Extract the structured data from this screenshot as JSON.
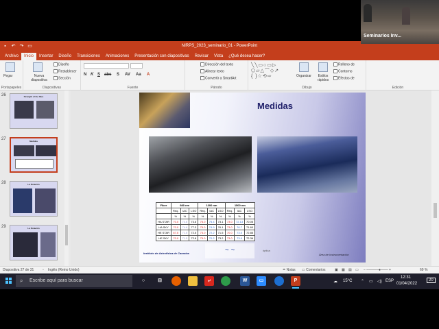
{
  "titlebar": {
    "title": "NIRPS_2023_seminario_01 - PowerPoint",
    "qat": [
      "save-icon",
      "undo-icon",
      "redo-icon",
      "present-icon"
    ]
  },
  "tabs": [
    "Archivo",
    "Inicio",
    "Insertar",
    "Diseño",
    "Transiciones",
    "Animaciones",
    "Presentación con diapositivas",
    "Revisar",
    "Vista",
    "¿Qué desea hacer?"
  ],
  "active_tab": "Inicio",
  "ribbon": {
    "groups": {
      "portapapeles": "Portapapeles",
      "diapositivas": "Diapositivas",
      "fuente": "Fuente",
      "parrafo": "Párrafo",
      "dibujo": "Dibujo",
      "edicion": "Edición"
    },
    "pegar": "Pegar",
    "nueva_diapositiva": "Nueva diapositiva",
    "diseno": "Diseño",
    "restablecer": "Restablecer",
    "seccion": "Sección",
    "direccion_texto": "Dirección del texto",
    "alinear_texto": "Alinear texto",
    "convertir_smartart": "Convertir a SmartArt",
    "organizar": "Organizar",
    "estilos_rapidos": "Estilos rápidos",
    "relleno": "Relleno de",
    "contorno": "Contorno",
    "efectos": "Efectos de",
    "format_buttons": [
      "N",
      "K",
      "S",
      "abc",
      "S",
      "AV",
      "Aa",
      "A"
    ]
  },
  "thumbnails": [
    {
      "num": "26",
      "title": "Strength of the fibre"
    },
    {
      "num": "27",
      "title": "Medidas"
    },
    {
      "num": "28",
      "title": "La Rotación"
    },
    {
      "num": "29",
      "title": "La Rotación"
    }
  ],
  "slide": {
    "title": "Medidas",
    "table": {
      "header_row1": [
        "Fiber",
        "980 nm",
        "1300 nm",
        "1500 nm"
      ],
      "header_row2": [
        "",
        "Req.",
        "IAC",
        "LSO",
        "Req.",
        "IAC",
        "LSO",
        "Req.",
        "IAC",
        "LSO"
      ],
      "units_row": [
        "",
        "%",
        "%",
        "%",
        "%",
        "%",
        "%",
        "%",
        "%",
        "%"
      ],
      "rows": [
        [
          "HA STAR",
          "70.0",
          "74.6",
          "73.6",
          "75.0",
          "75.4",
          "73.1",
          "73.0",
          "72.13",
          "70.05"
        ],
        [
          "HA SKY",
          "70.0",
          "74.6",
          "77.3",
          "75.0",
          "74.9",
          "76.1",
          "73.0",
          "76.7",
          "71.60"
        ],
        [
          "HE STAR",
          "67.5",
          "71.5",
          "72.5",
          "73.0",
          "72.2",
          "71.5",
          "70.0",
          "73.0",
          "72.85"
        ],
        [
          "HE SKY",
          "70.0",
          "71.5",
          "72.8",
          "75.0",
          "70.2",
          "73.2",
          "73.0",
          "73.0",
          "72.36"
        ]
      ]
    },
    "institution": "Instituto de Astrofísica de Canarias",
    "area": "Área de Instrumentación",
    "caption": "óptica"
  },
  "statusbar": {
    "slide_info": "Diapositiva 27 de 31",
    "language": "Inglés (Reino Unido)",
    "notes": "Notas",
    "comments": "Comentarios",
    "zoom": "69 %"
  },
  "taskbar": {
    "search_placeholder": "Escribe aquí para buscar",
    "apps": [
      "task-view-icon",
      "browser-icon",
      "firefox-icon",
      "explorer-icon",
      "acrobat-icon",
      "chrome-icon",
      "word-icon",
      "zoom-icon",
      "webex-icon",
      "powerpoint-icon"
    ],
    "weather": "15°C",
    "lang": "ESP",
    "time": "12:31",
    "date": "01/04/2022",
    "notif": "20"
  },
  "webcam": {
    "label": "Seminarios Inv..."
  },
  "colors": {
    "accent": "#c43e1c",
    "taskbar": "#1f1f2c",
    "slide_title": "#20206a"
  }
}
